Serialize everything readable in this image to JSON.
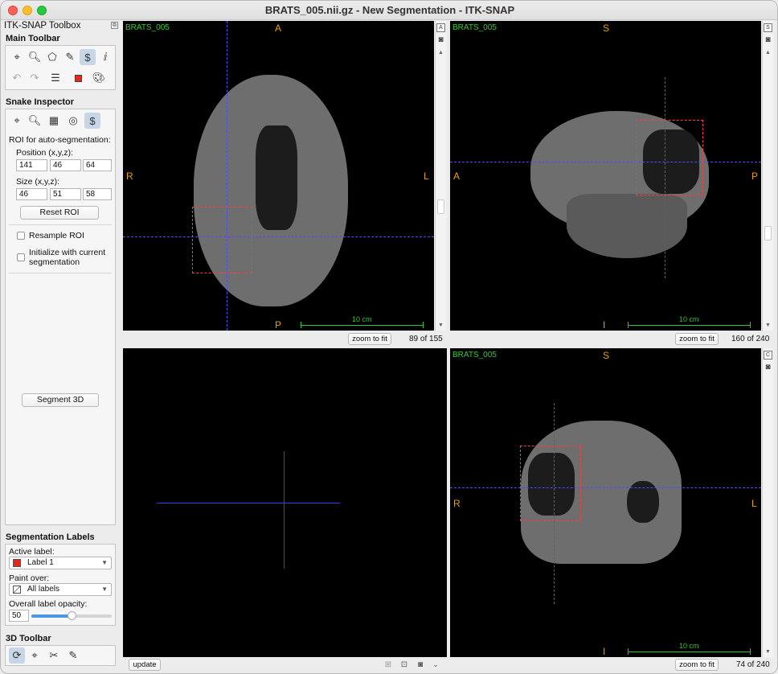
{
  "window": {
    "title": "BRATS_005.nii.gz - New Segmentation - ITK-SNAP"
  },
  "toolbox": {
    "title": "ITK-SNAP Toolbox",
    "main_toolbar_label": "Main Toolbar",
    "snake_inspector_label": "Snake Inspector",
    "roi_label": "ROI for auto-segmentation:",
    "position_label": "Position (x,y,z):",
    "position": [
      "141",
      "46",
      "64"
    ],
    "size_label": "Size (x,y,z):",
    "size": [
      "46",
      "51",
      "58"
    ],
    "reset_roi": "Reset ROI",
    "resample_roi": "Resample ROI",
    "init_with_seg": "Initialize with current segmentation",
    "segment_3d": "Segment 3D",
    "seg_labels_label": "Segmentation Labels",
    "active_label_caption": "Active label:",
    "active_label": "Label 1",
    "active_label_color": "#e02a1c",
    "paint_over_caption": "Paint over:",
    "paint_over": "All labels",
    "opacity_caption": "Overall label opacity:",
    "opacity_value": "50",
    "opacity_fraction": 0.5,
    "toolbar_3d_label": "3D Toolbar"
  },
  "views": {
    "axial": {
      "name": "BRATS_005",
      "top": "A",
      "bottom": "P",
      "left": "R",
      "right": "L",
      "scale": "10 cm",
      "zoom": "zoom to fit",
      "slice": "89 of 155"
    },
    "sagittal": {
      "name": "BRATS_005",
      "top": "S",
      "bottom": "I",
      "left": "A",
      "right": "P",
      "scale": "10 cm",
      "zoom": "zoom to fit",
      "slice": "160 of 240"
    },
    "coronal": {
      "name": "BRATS_005",
      "top": "S",
      "bottom": "I",
      "left": "R",
      "right": "L",
      "scale": "10 cm",
      "zoom": "zoom to fit",
      "slice": "74 of 240"
    },
    "three_d": {
      "update": "update"
    }
  },
  "icons": {
    "axial_corner": "A",
    "sagittal_corner": "S",
    "coronal_corner": "C"
  }
}
